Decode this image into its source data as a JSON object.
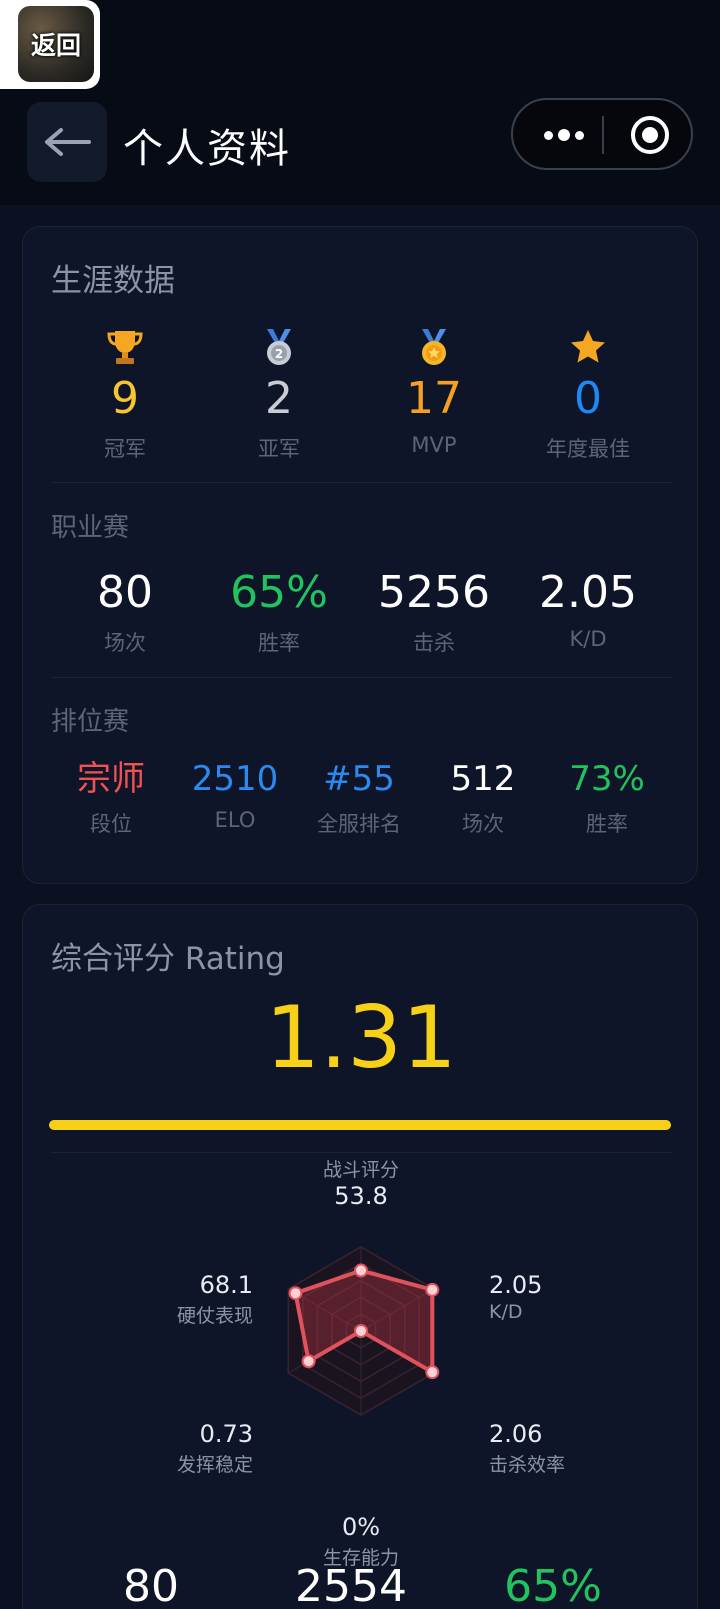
{
  "header": {
    "back_thumb_label": "返回",
    "title": "个人资料",
    "back_icon": "arrow-left-icon",
    "more_icon": "more-dots-icon",
    "target_icon": "record-target-icon"
  },
  "career": {
    "title": "生涯数据",
    "honors": [
      {
        "icon": "trophy-icon",
        "value": "9",
        "label": "冠军",
        "color": "#f7c532"
      },
      {
        "icon": "silver-medal-icon",
        "value": "2",
        "label": "亚军",
        "color": "#c9ccd3"
      },
      {
        "icon": "gold-medal-icon",
        "value": "17",
        "label": "MVP",
        "color": "#f5a021"
      },
      {
        "icon": "star-icon",
        "value": "0",
        "label": "年度最佳",
        "color": "#1e88f5"
      }
    ],
    "pro": {
      "title": "职业赛",
      "stats": [
        {
          "value": "80",
          "label": "场次",
          "color": "#ffffff"
        },
        {
          "value": "65%",
          "label": "胜率",
          "color": "#22c35e"
        },
        {
          "value": "5256",
          "label": "击杀",
          "color": "#ffffff"
        },
        {
          "value": "2.05",
          "label": "K/D",
          "color": "#ffffff"
        }
      ]
    },
    "ranked": {
      "title": "排位赛",
      "stats": [
        {
          "value": "宗师",
          "label": "段位",
          "color": "#f05252"
        },
        {
          "value": "2510",
          "label": "ELO",
          "color": "#2a8af0"
        },
        {
          "value": "#55",
          "label": "全服排名",
          "color": "#2a8af0"
        },
        {
          "value": "512",
          "label": "场次",
          "color": "#ffffff"
        },
        {
          "value": "73%",
          "label": "胜率",
          "color": "#22c35e"
        }
      ]
    }
  },
  "rating": {
    "title": "综合评分 Rating",
    "value": "1.31",
    "bar_fraction": 1.0,
    "color": "#f7d117",
    "radar": {
      "top": {
        "value": "53.8",
        "label": "战斗评分"
      },
      "top_right": {
        "value": "2.05",
        "label": "K/D"
      },
      "bottom_right": {
        "value": "2.06",
        "label": "击杀效率"
      },
      "bottom": {
        "value": "0%",
        "label": "生存能力"
      },
      "bottom_left": {
        "value": "0.73",
        "label": "发挥稳定"
      },
      "top_left": {
        "value": "68.1",
        "label": "硬仗表现"
      },
      "levels": [
        0.72,
        0.98,
        0.98,
        0.0,
        0.72,
        0.9
      ]
    },
    "bottom_stats": [
      {
        "value": "80",
        "color": "#ffffff"
      },
      {
        "value": "2554",
        "color": "#ffffff"
      },
      {
        "value": "65%",
        "color": "#22c35e"
      }
    ]
  }
}
